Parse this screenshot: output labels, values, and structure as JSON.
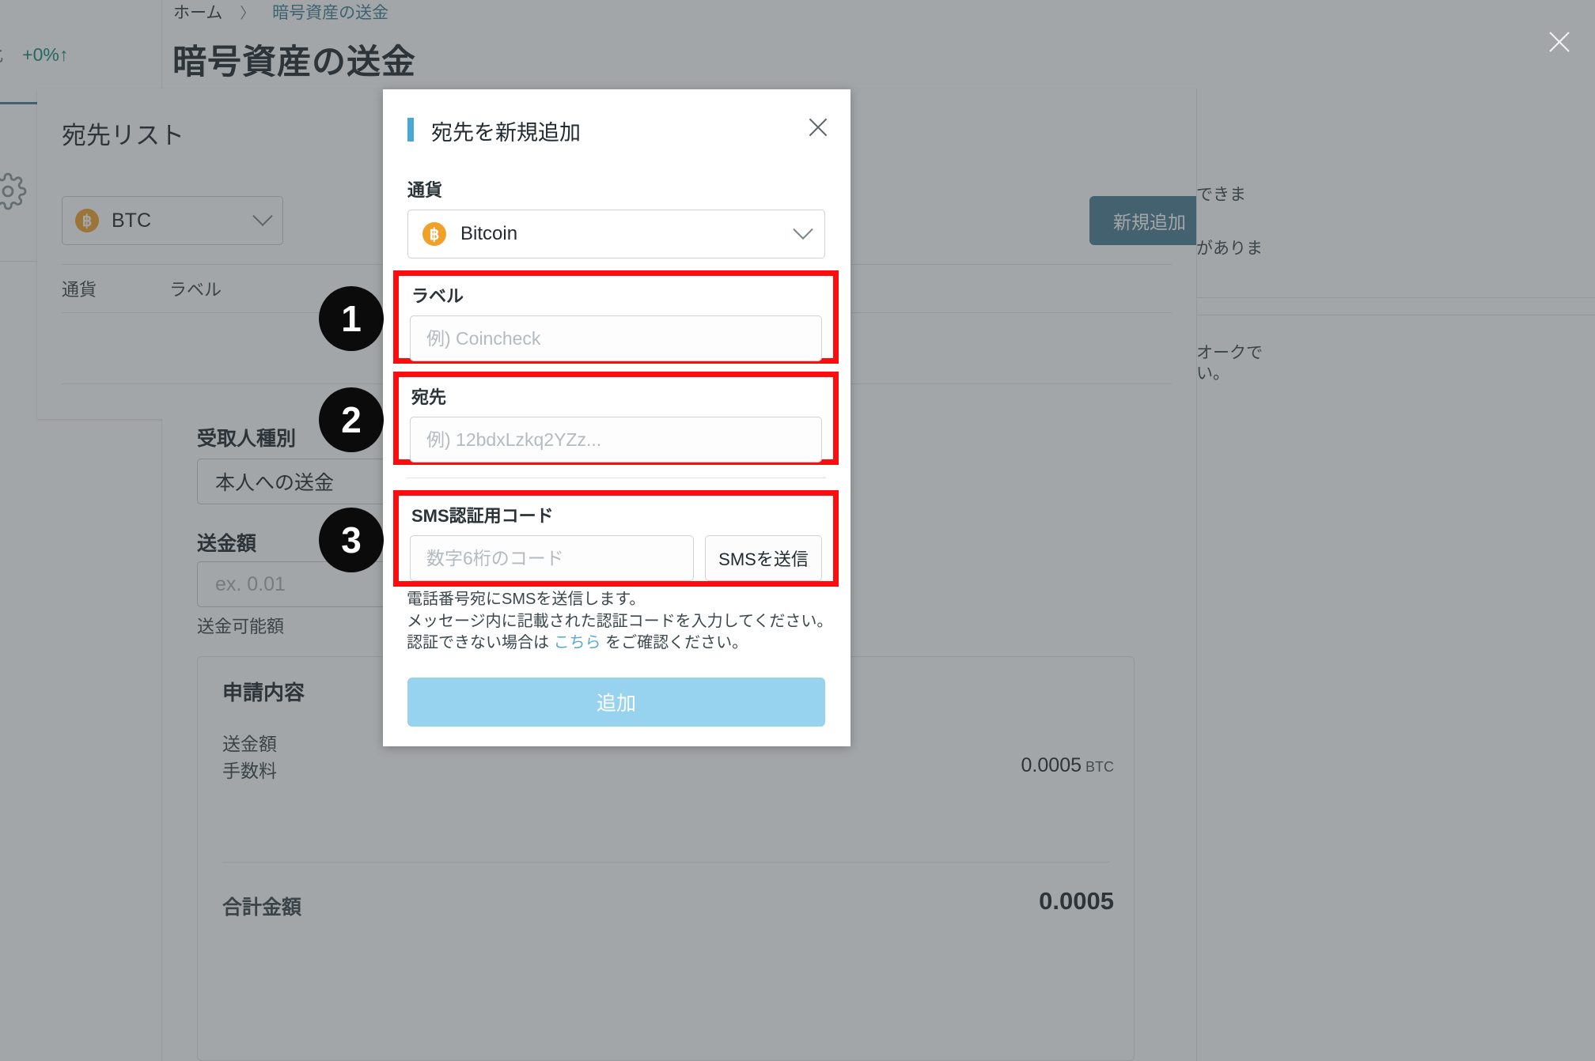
{
  "colors": {
    "accent_blue": "#4aa8d8",
    "highlight_red": "#fd0d0d",
    "primary_button": "#97d3ef",
    "teal_button": "#4a7d91",
    "bitcoin_orange": "#f0a12a",
    "link_blue": "#5ba9cc",
    "positive_green": "#15897a"
  },
  "background": {
    "sidebar": {
      "stat_label": "月比",
      "stat_value": "+0%↑",
      "gear_icon": "gear-icon"
    },
    "breadcrumb": {
      "home": "ホーム",
      "separator": "〉",
      "current": "暗号資産の送金"
    },
    "page_title": "暗号資産の送金",
    "address_list_card": {
      "title": "宛先リスト",
      "coin_select": {
        "icon": "bitcoin-icon",
        "value": "BTC"
      },
      "table_headers": [
        "通貨",
        "ラベル"
      ],
      "new_button": "新規追加",
      "close_icon": "close-icon"
    },
    "right_column": {
      "line1": "できま",
      "line2": "がありま",
      "line3": "オークで",
      "line4": "い。"
    },
    "send_form": {
      "recipient_type_label": "受取人種別",
      "recipient_type_value": "本人への送金",
      "amount_label": "送金額",
      "amount_placeholder": "ex. 0.01",
      "available_label": "送金可能額",
      "summary": {
        "title": "申請内容",
        "rows": [
          {
            "label": "送金額",
            "value": "",
            "unit": ""
          },
          {
            "label": "手数料",
            "value": "0.0005",
            "unit": "BTC"
          },
          {
            "label": "合計金額",
            "value": "0.0005",
            "unit": ""
          }
        ]
      }
    }
  },
  "modal": {
    "title": "宛先を新規追加",
    "close_icon": "close-icon",
    "currency": {
      "label": "通貨",
      "icon": "bitcoin-icon",
      "selected": "Bitcoin",
      "chevron_icon": "chevron-down-icon"
    },
    "label_field": {
      "label": "ラベル",
      "value": "",
      "placeholder": "例) Coincheck"
    },
    "address_field": {
      "label": "宛先",
      "value": "",
      "placeholder": "例) 12bdxLzkq2YZz..."
    },
    "sms_field": {
      "label": "SMS認証用コード",
      "value": "",
      "placeholder": "数字6桁のコード",
      "send_button": "SMSを送信"
    },
    "help": {
      "line1": "電話番号宛にSMSを送信します。",
      "line2": "メッセージ内に記載された認証コードを入力してください。",
      "line3_before": "認証できない場合は ",
      "link": "こちら",
      "line3_after": " をご確認ください。"
    },
    "submit_button": "追加"
  },
  "step_badges": [
    {
      "number": "1",
      "target": "label-field"
    },
    {
      "number": "2",
      "target": "address-field"
    },
    {
      "number": "3",
      "target": "sms-field"
    }
  ]
}
